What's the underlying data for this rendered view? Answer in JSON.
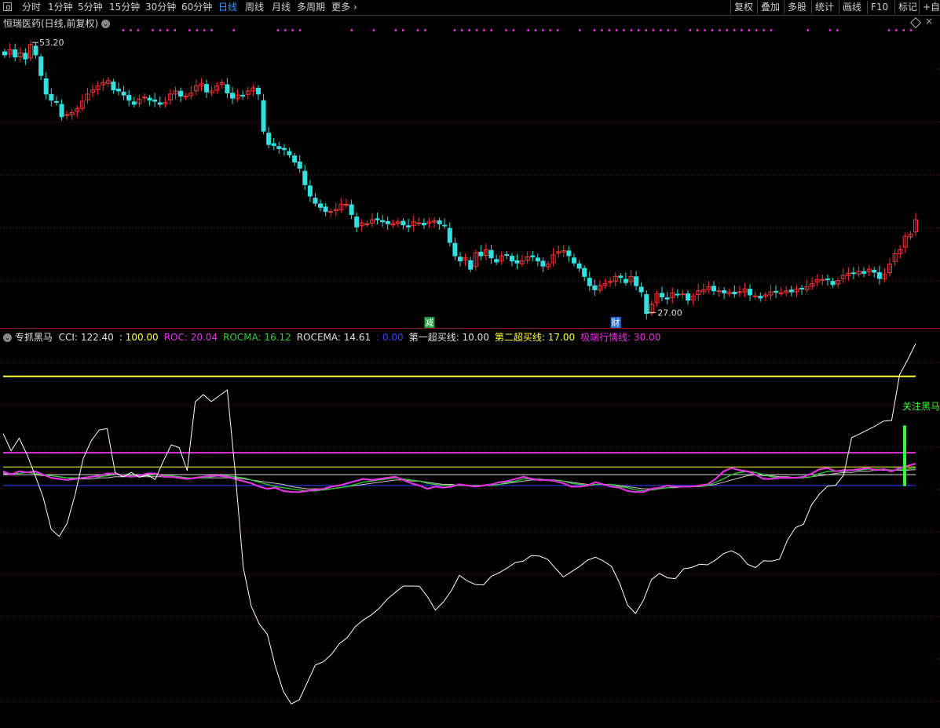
{
  "toolbar": {
    "periods": [
      "分时",
      "1分钟",
      "5分钟",
      "15分钟",
      "30分钟",
      "60分钟",
      "日线",
      "周线",
      "月线",
      "多周期",
      "更多"
    ],
    "active_period": "日线",
    "more_chevron": "›",
    "buttons": [
      "复权",
      "叠加",
      "多股",
      "统计",
      "画线",
      "F10",
      "标记",
      "+自"
    ]
  },
  "main_panel": {
    "title": "恒瑞医药(日线,前复权)",
    "high_label": "53.20",
    "low_label": "27.00",
    "badges": [
      {
        "text": "减",
        "color": "#1e9e3e",
        "bar": 82
      },
      {
        "text": "财",
        "color": "#2a6fd6",
        "bar": 118
      }
    ]
  },
  "indicator_panel": {
    "name": "专抓黑马",
    "readouts": [
      {
        "label": "CCI: 122.40",
        "color": "#e0e0e0"
      },
      {
        "label": ": 100.00",
        "color": "#ffff33"
      },
      {
        "label": "ROC: 20.04",
        "color": "#e033e0"
      },
      {
        "label": "ROCMA: 16.12",
        "color": "#33cc33"
      },
      {
        "label": "ROCEMA: 14.61",
        "color": "#e0e0e0"
      },
      {
        "label": ": 0.00",
        "color": "#3344ff"
      },
      {
        "label": "第一超买线: 10.00",
        "color": "#e0e0e0"
      },
      {
        "label": "第二超买线: 17.00",
        "color": "#ffff33"
      },
      {
        "label": "极端行情线: 30.00",
        "color": "#e033e0"
      }
    ],
    "signal_text": "关注黑马"
  },
  "colors": {
    "up": "#ff3333",
    "down": "#33e0e0",
    "grid": "#6a1a1a",
    "cci": "#ffffff",
    "roc": "#e033e0",
    "rocma": "#33cc33",
    "rocema": "#c8c8c8",
    "line100": "#ffff33",
    "zero": "#3344ff",
    "signal": "#33ff33",
    "dots": "#cc33cc"
  },
  "chart_data": [
    {
      "type": "candlestick",
      "title": "恒瑞医药(日线,前复权)",
      "ylim": [
        25.5,
        55.5
      ],
      "y_max_marked": 53.2,
      "y_min_marked": 27.0,
      "closes": [
        52.0,
        52.5,
        51.8,
        52.2,
        51.6,
        53.0,
        52.0,
        50.0,
        48.2,
        47.6,
        47.4,
        46.0,
        46.2,
        46.4,
        46.8,
        47.5,
        48.2,
        48.6,
        49.0,
        49.3,
        49.5,
        48.6,
        48.5,
        48.1,
        47.6,
        47.2,
        47.7,
        47.9,
        47.6,
        47.5,
        47.2,
        47.4,
        48.2,
        48.5,
        48.0,
        48.0,
        48.3,
        49.0,
        49.2,
        48.4,
        48.5,
        49.0,
        49.3,
        48.3,
        47.8,
        48.1,
        48.0,
        48.5,
        48.8,
        48.2,
        44.6,
        43.3,
        43.2,
        42.9,
        42.8,
        42.3,
        41.6,
        41.0,
        39.4,
        38.3,
        37.6,
        37.2,
        36.8,
        36.8,
        37.0,
        37.5,
        37.5,
        36.5,
        35.3,
        35.7,
        35.6,
        36.0,
        36.0,
        35.8,
        35.6,
        35.6,
        35.8,
        35.5,
        35.3,
        35.8,
        35.7,
        35.5,
        35.8,
        35.9,
        35.6,
        35.4,
        33.8,
        32.5,
        32.0,
        32.3,
        31.2,
        32.8,
        32.5,
        33.1,
        32.3,
        31.9,
        32.5,
        32.6,
        32.0,
        31.8,
        32.0,
        32.4,
        32.4,
        32.0,
        31.5,
        31.7,
        32.6,
        32.9,
        33.0,
        32.5,
        31.8,
        31.3,
        30.5,
        29.6,
        29.2,
        29.6,
        29.8,
        30.0,
        30.5,
        30.4,
        29.9,
        30.5,
        29.6,
        29.0,
        26.9,
        27.8,
        28.8,
        28.5,
        28.3,
        28.9,
        28.7,
        28.8,
        28.2,
        28.6,
        29.1,
        29.2,
        29.5,
        29.1,
        29.1,
        28.9,
        29.0,
        28.8,
        29.0,
        29.3,
        28.7,
        28.6,
        28.4,
        28.7,
        29.0,
        29.0,
        28.9,
        29.1,
        29.0,
        29.3,
        29.3,
        29.5,
        29.8,
        30.2,
        30.2,
        30.2,
        29.7,
        30.1,
        30.6,
        30.8,
        30.8,
        31.0,
        30.8,
        31.2,
        30.9,
        30.3,
        30.7,
        31.7,
        32.7,
        33.1,
        34.4,
        34.6,
        36.0
      ]
    },
    {
      "type": "line",
      "title": "专抓黑马",
      "ylim": [
        -220,
        130
      ],
      "series": [
        {
          "name": "CCI",
          "values": [
            47.6,
            31.8,
            43.4,
            28.0,
            9.1,
            -10.9,
            -40.0,
            -46.7,
            -34.6,
            -8.1,
            24.6,
            40.9,
            50.9,
            52.2,
            11.7,
            7.9,
            12.0,
            7.6,
            9.7,
            5.5,
            22.2,
            37.3,
            34.7,
            13.6,
            76.6,
            83.2,
            76.9,
            82.2,
            87.6,
            11.4,
            -75.2,
            -110.7,
            -127.0,
            -136.2,
            -165.5,
            -188.7,
            -200.0,
            -196.3,
            -180.5,
            -164.5,
            -161.5,
            -154.9,
            -145.0,
            -139.2,
            -129.2,
            -123.2,
            -118.5,
            -112.4,
            -103.9,
            -98.0,
            -92.1,
            -92.1,
            -92.2,
            -101.7,
            -114.1,
            -106.7,
            -96.3,
            -82.3,
            -87.5,
            -90.7,
            -91.1,
            -83.0,
            -79.8,
            -75.5,
            -70.5,
            -69.3,
            -64.2,
            -64.6,
            -67.5,
            -75.8,
            -83.8,
            -79.0,
            -74.2,
            -68.4,
            -65.7,
            -69.2,
            -74.1,
            -89.3,
            -109.5,
            -117.2,
            -105.0,
            -86.2,
            -80.5,
            -84.6,
            -85.3,
            -76.3,
            -75.2,
            -72.1,
            -72.7,
            -68.2,
            -62.4,
            -59.7,
            -63.6,
            -72.2,
            -75.2,
            -69.0,
            -69.2,
            -67.5,
            -49.8,
            -38.5,
            -35.4,
            -17.6,
            -7.8,
            -0.6,
            0.2,
            9.6,
            43.8,
            47.2,
            51.0,
            54.7,
            59.1,
            59.6,
            101.6,
            115.2,
            130.0
          ]
        },
        {
          "name": "ROC",
          "values": [
            13.0,
            10.0,
            13.0,
            12.0,
            13.0,
            10.0,
            7.0,
            6.0,
            5.0,
            6.0,
            7.0,
            8.0,
            9.0,
            11.0,
            11.0,
            9.0,
            8.0,
            9.0,
            11.0,
            11.0,
            8.0,
            8.0,
            7.0,
            6.0,
            7.0,
            8.0,
            9.0,
            9.0,
            8.0,
            6.0,
            4.0,
            2.0,
            -1.0,
            -3.0,
            -2.0,
            -5.0,
            -6.0,
            -6.0,
            -5.0,
            -4.0,
            -3.0,
            -1.0,
            0.0,
            2.0,
            4.0,
            6.0,
            5.0,
            6.0,
            7.0,
            8.0,
            5.0,
            2.0,
            0.0,
            -3.0,
            -1.0,
            -2.0,
            -1.0,
            1.0,
            0.0,
            -1.0,
            0.0,
            1.0,
            3.0,
            4.0,
            6.0,
            8.0,
            6.0,
            5.0,
            5.0,
            4.0,
            2.0,
            -1.0,
            -1.0,
            0.0,
            3.0,
            1.0,
            -1.0,
            -2.0,
            -5.0,
            -6.0,
            -6.0,
            -3.0,
            -2.0,
            0.0,
            -1.0,
            -1.0,
            -1.0,
            0.0,
            1.0,
            6.0,
            13.0,
            16.0,
            14.0,
            13.0,
            10.0,
            6.0,
            6.0,
            7.0,
            7.0,
            7.0,
            8.0,
            11.0,
            15.0,
            16.0,
            13.0,
            14.0,
            14.0,
            15.0,
            16.0,
            14.0,
            15.0,
            13.0,
            16.0,
            18.0,
            20.0
          ]
        },
        {
          "name": "ROCMA",
          "values": [
            12.0,
            11.0,
            11.0,
            12.0,
            11.0,
            10.0,
            9.0,
            8.0,
            7.0,
            7.0,
            7.0,
            8.0,
            8.0,
            9.0,
            10.0,
            10.0,
            9.0,
            9.0,
            9.0,
            10.0,
            9.0,
            9.0,
            8.0,
            7.0,
            7.0,
            7.0,
            8.0,
            9.0,
            9.0,
            8.0,
            7.0,
            5.0,
            3.0,
            1.0,
            -1.0,
            -2.0,
            -3.0,
            -4.0,
            -5.0,
            -5.0,
            -4.0,
            -3.0,
            -2.0,
            -1.0,
            1.0,
            3.0,
            4.0,
            5.0,
            6.0,
            7.0,
            6.0,
            5.0,
            4.0,
            2.0,
            1.0,
            0.0,
            0.0,
            0.0,
            0.0,
            0.0,
            0.0,
            0.0,
            1.0,
            3.0,
            4.0,
            6.0,
            6.0,
            6.0,
            5.0,
            5.0,
            4.0,
            2.0,
            1.0,
            0.0,
            1.0,
            1.0,
            1.0,
            -1.0,
            -2.0,
            -4.0,
            -5.0,
            -4.0,
            -3.0,
            -2.0,
            -1.0,
            -1.0,
            -1.0,
            -1.0,
            0.0,
            3.0,
            6.0,
            10.0,
            12.0,
            13.0,
            12.0,
            10.0,
            8.0,
            7.0,
            7.0,
            7.0,
            7.0,
            8.0,
            11.0,
            13.0,
            13.0,
            13.0,
            14.0,
            14.0,
            15.0,
            15.0,
            15.0,
            14.0,
            15.0,
            15.0,
            16.1
          ]
        },
        {
          "name": "ROCEMA",
          "values": [
            11.0,
            10.0,
            10.0,
            10.0,
            10.0,
            9.0,
            9.0,
            8.0,
            7.0,
            6.0,
            6.0,
            6.0,
            7.0,
            7.0,
            8.0,
            8.0,
            8.0,
            8.0,
            8.0,
            8.0,
            8.0,
            8.0,
            8.0,
            7.0,
            7.0,
            7.0,
            7.0,
            7.0,
            7.0,
            7.0,
            6.0,
            5.0,
            4.0,
            3.0,
            2.0,
            1.0,
            -1.0,
            -2.0,
            -3.0,
            -3.0,
            -3.0,
            -3.0,
            -2.0,
            -1.0,
            0.0,
            1.0,
            2.0,
            3.0,
            4.0,
            5.0,
            5.0,
            4.0,
            4.0,
            3.0,
            2.0,
            1.0,
            1.0,
            0.0,
            0.0,
            0.0,
            0.0,
            0.0,
            1.0,
            2.0,
            3.0,
            4.0,
            5.0,
            5.0,
            5.0,
            5.0,
            4.0,
            3.0,
            2.0,
            1.0,
            1.0,
            1.0,
            1.0,
            0.0,
            -1.0,
            -2.0,
            -3.0,
            -3.0,
            -3.0,
            -2.0,
            -2.0,
            -1.0,
            -1.0,
            -1.0,
            0.0,
            1.0,
            3.0,
            5.0,
            7.0,
            9.0,
            10.0,
            9.0,
            9.0,
            8.0,
            8.0,
            7.0,
            7.0,
            8.0,
            9.0,
            10.0,
            11.0,
            12.0,
            12.0,
            13.0,
            13.0,
            14.0,
            14.0,
            14.0,
            14.0,
            14.0,
            14.6
          ]
        }
      ],
      "hlines": [
        {
          "name": "100",
          "value": 100
        },
        {
          "name": "极端行情线",
          "value": 30
        },
        {
          "name": "第二超买线",
          "value": 17
        },
        {
          "name": "第一超买线",
          "value": 10
        },
        {
          "name": "0",
          "value": 0
        }
      ],
      "signal_bar_value": [
        -0.5,
        55
      ]
    }
  ]
}
